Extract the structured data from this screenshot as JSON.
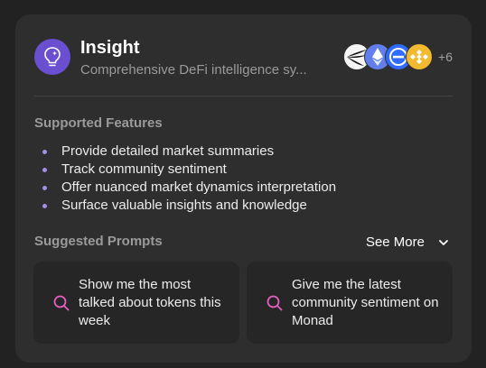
{
  "header": {
    "title": "Insight",
    "subtitle": "Comprehensive DeFi intelligence sy...",
    "tokens": [
      {
        "icon": "wing-logo-icon",
        "bg": "#f5f5f5"
      },
      {
        "icon": "ethereum-icon",
        "bg": "#627eea"
      },
      {
        "icon": "minus-coin-icon",
        "bg": "#2f6bff"
      },
      {
        "icon": "bnb-icon",
        "bg": "#f3ba2f"
      }
    ],
    "more_count": "+6"
  },
  "features": {
    "label": "Supported Features",
    "items": [
      "Provide detailed market summaries",
      "Track community sentiment",
      "Offer nuanced market dynamics interpretation",
      "Surface valuable insights and knowledge"
    ]
  },
  "prompts": {
    "label": "Suggested Prompts",
    "see_more": "See More",
    "items": [
      "Show me the most talked about tokens this week",
      "Give me the latest community sentiment on Monad"
    ]
  },
  "colors": {
    "accent": "#6a4fd1",
    "bullet": "#a58ee6",
    "search_icon": "#e45fc0"
  }
}
